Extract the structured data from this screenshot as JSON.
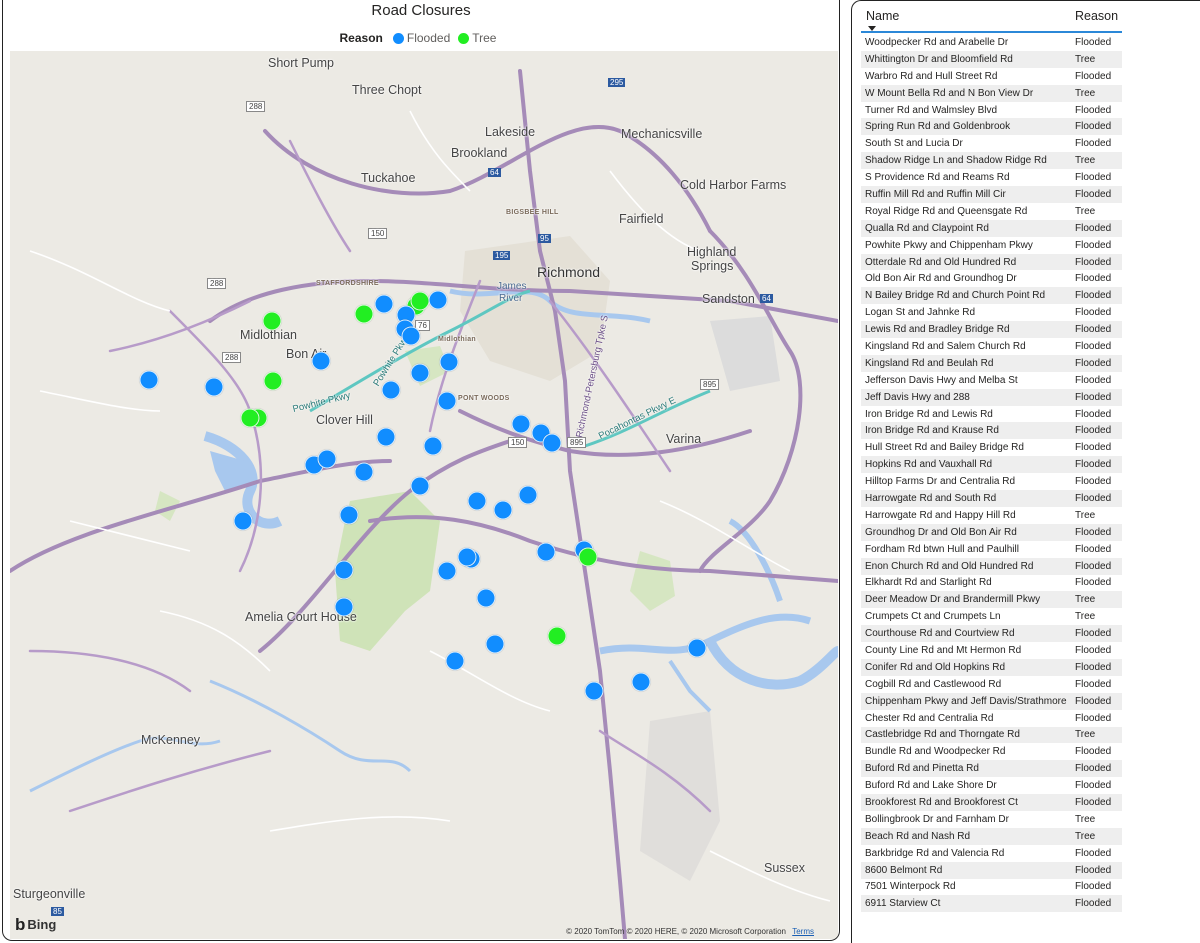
{
  "map": {
    "title": "Road Closures",
    "legend": {
      "title": "Reason",
      "items": [
        {
          "label": "Flooded",
          "color": "#118dff"
        },
        {
          "label": "Tree",
          "color": "#22ee22"
        }
      ]
    },
    "places": [
      "Short Pump",
      "Three Chopt",
      "Lakeside",
      "Brookland",
      "Mechanicsville",
      "Tuckahoe",
      "Cold Harbor Farms",
      "Fairfield",
      "Highland",
      "Springs",
      "Richmond",
      "James",
      "River",
      "Sandston",
      "Midlothian",
      "Bon Air",
      "Midlothian",
      "Clover Hill",
      "Varina",
      "Amelia Court House",
      "McKenney",
      "Sussex",
      "Sturgeonville",
      "STAFFORDSHIRE",
      "BIGSBEE HILL",
      "PONT WOODS"
    ],
    "road_labels": [
      "Powhite Pkwy",
      "Powhite Pkwy S",
      "Richmond-Petersburg Tpke S",
      "Pocahontas Pkwy E"
    ],
    "route_shields": [
      "288",
      "150",
      "64",
      "295",
      "95",
      "195",
      "76",
      "895",
      "150",
      "895",
      "85",
      "288",
      "288",
      "64"
    ],
    "closures": [
      {
        "reason": "Tree"
      },
      {
        "reason": "Tree"
      },
      {
        "reason": "Flooded"
      },
      {
        "reason": "Tree"
      },
      {
        "reason": "Tree"
      },
      {
        "reason": "Flooded"
      },
      {
        "reason": "Flooded"
      },
      {
        "reason": "Flooded"
      },
      {
        "reason": "Flooded"
      },
      {
        "reason": "Tree"
      },
      {
        "reason": "Flooded"
      },
      {
        "reason": "Flooded"
      },
      {
        "reason": "Flooded"
      },
      {
        "reason": "Tree"
      },
      {
        "reason": "Tree"
      },
      {
        "reason": "Flooded"
      },
      {
        "reason": "Flooded"
      },
      {
        "reason": "Flooded"
      },
      {
        "reason": "Flooded"
      },
      {
        "reason": "Flooded"
      },
      {
        "reason": "Flooded"
      },
      {
        "reason": "Flooded"
      },
      {
        "reason": "Flooded"
      },
      {
        "reason": "Flooded"
      },
      {
        "reason": "Flooded"
      },
      {
        "reason": "Flooded"
      },
      {
        "reason": "Flooded"
      },
      {
        "reason": "Flooded"
      },
      {
        "reason": "Flooded"
      },
      {
        "reason": "Flooded"
      },
      {
        "reason": "Flooded"
      },
      {
        "reason": "Flooded"
      },
      {
        "reason": "Flooded"
      },
      {
        "reason": "Flooded"
      },
      {
        "reason": "Flooded"
      },
      {
        "reason": "Tree"
      },
      {
        "reason": "Flooded"
      },
      {
        "reason": "Flooded"
      },
      {
        "reason": "Flooded"
      },
      {
        "reason": "Flooded"
      },
      {
        "reason": "Tree"
      },
      {
        "reason": "Flooded"
      },
      {
        "reason": "Flooded"
      },
      {
        "reason": "Flooded"
      },
      {
        "reason": "Flooded"
      },
      {
        "reason": "Flooded"
      },
      {
        "reason": "Flooded"
      },
      {
        "reason": "Flooded"
      }
    ],
    "logo_text": "Bing",
    "copyright": "© 2020 TomTom © 2020 HERE, © 2020 Microsoft Corporation",
    "terms_label": "Terms"
  },
  "table": {
    "columns": {
      "name": "Name",
      "reason": "Reason"
    },
    "rows": [
      {
        "name": "Woodpecker Rd and Arabelle Dr",
        "reason": "Flooded"
      },
      {
        "name": "Whittington Dr and Bloomfield Rd",
        "reason": "Tree"
      },
      {
        "name": "Warbro Rd and Hull Street Rd",
        "reason": "Flooded"
      },
      {
        "name": "W Mount Bella Rd and N Bon View Dr",
        "reason": "Tree"
      },
      {
        "name": "Turner Rd and Walmsley Blvd",
        "reason": "Flooded"
      },
      {
        "name": "Spring Run Rd and Goldenbrook",
        "reason": "Flooded"
      },
      {
        "name": "South St and Lucia Dr",
        "reason": "Flooded"
      },
      {
        "name": "Shadow Ridge Ln and Shadow Ridge Rd",
        "reason": "Tree"
      },
      {
        "name": "S Providence Rd and Reams Rd",
        "reason": "Flooded"
      },
      {
        "name": "Ruffin Mill Rd and Ruffin Mill Cir",
        "reason": "Flooded"
      },
      {
        "name": "Royal Ridge Rd and Queensgate Rd",
        "reason": "Tree"
      },
      {
        "name": "Qualla Rd and Claypoint Rd",
        "reason": "Flooded"
      },
      {
        "name": "Powhite Pkwy and Chippenham Pkwy",
        "reason": "Flooded"
      },
      {
        "name": "Otterdale Rd and Old Hundred Rd",
        "reason": "Flooded"
      },
      {
        "name": "Old Bon Air Rd and Groundhog Dr",
        "reason": "Flooded"
      },
      {
        "name": "N Bailey Bridge Rd and Church Point Rd",
        "reason": "Flooded"
      },
      {
        "name": "Logan St and Jahnke Rd",
        "reason": "Flooded"
      },
      {
        "name": "Lewis Rd and Bradley Bridge Rd",
        "reason": "Flooded"
      },
      {
        "name": "Kingsland Rd and Salem Church Rd",
        "reason": "Flooded"
      },
      {
        "name": "Kingsland Rd and Beulah Rd",
        "reason": "Flooded"
      },
      {
        "name": "Jefferson Davis Hwy and Melba St",
        "reason": "Flooded"
      },
      {
        "name": "Jeff Davis Hwy and 288",
        "reason": "Flooded"
      },
      {
        "name": "Iron Bridge Rd and Lewis Rd",
        "reason": "Flooded"
      },
      {
        "name": "Iron Bridge Rd and Krause Rd",
        "reason": "Flooded"
      },
      {
        "name": "Hull Street Rd and Bailey Bridge Rd",
        "reason": "Flooded"
      },
      {
        "name": "Hopkins Rd and Vauxhall Rd",
        "reason": "Flooded"
      },
      {
        "name": "Hilltop Farms Dr and Centralia Rd",
        "reason": "Flooded"
      },
      {
        "name": "Harrowgate Rd and South Rd",
        "reason": "Flooded"
      },
      {
        "name": "Harrowgate Rd and Happy Hill Rd",
        "reason": "Tree"
      },
      {
        "name": "Groundhog Dr and Old Bon Air Rd",
        "reason": "Flooded"
      },
      {
        "name": "Fordham Rd btwn Hull and Paulhill",
        "reason": "Flooded"
      },
      {
        "name": "Enon Church Rd and Old Hundred Rd",
        "reason": "Flooded"
      },
      {
        "name": "Elkhardt Rd and Starlight Rd",
        "reason": "Flooded"
      },
      {
        "name": "Deer Meadow Dr and Brandermill Pkwy",
        "reason": "Tree"
      },
      {
        "name": "Crumpets Ct and Crumpets Ln",
        "reason": "Tree"
      },
      {
        "name": "Courthouse Rd and Courtview Rd",
        "reason": "Flooded"
      },
      {
        "name": "County Line Rd and Mt Hermon Rd",
        "reason": "Flooded"
      },
      {
        "name": "Conifer Rd and Old Hopkins Rd",
        "reason": "Flooded"
      },
      {
        "name": "Cogbill Rd and Castlewood Rd",
        "reason": "Flooded"
      },
      {
        "name": "Chippenham Pkwy and Jeff Davis/Strathmore",
        "reason": "Flooded"
      },
      {
        "name": "Chester Rd and Centralia Rd",
        "reason": "Flooded"
      },
      {
        "name": "Castlebridge Rd and Thorngate Rd",
        "reason": "Tree"
      },
      {
        "name": "Bundle Rd and Woodpecker Rd",
        "reason": "Flooded"
      },
      {
        "name": "Buford Rd and Pinetta Rd",
        "reason": "Flooded"
      },
      {
        "name": "Buford Rd and Lake Shore Dr",
        "reason": "Flooded"
      },
      {
        "name": "Brookforest Rd and Brookforest Ct",
        "reason": "Flooded"
      },
      {
        "name": "Bollingbrook Dr and Farnham Dr",
        "reason": "Tree"
      },
      {
        "name": "Beach Rd and Nash Rd",
        "reason": "Tree"
      },
      {
        "name": "Barkbridge Rd and Valencia Rd",
        "reason": "Flooded"
      },
      {
        "name": "8600 Belmont Rd",
        "reason": "Flooded"
      },
      {
        "name": "7501 Winterpock Rd",
        "reason": "Flooded"
      },
      {
        "name": "6911 Starview Ct",
        "reason": "Flooded"
      }
    ]
  }
}
